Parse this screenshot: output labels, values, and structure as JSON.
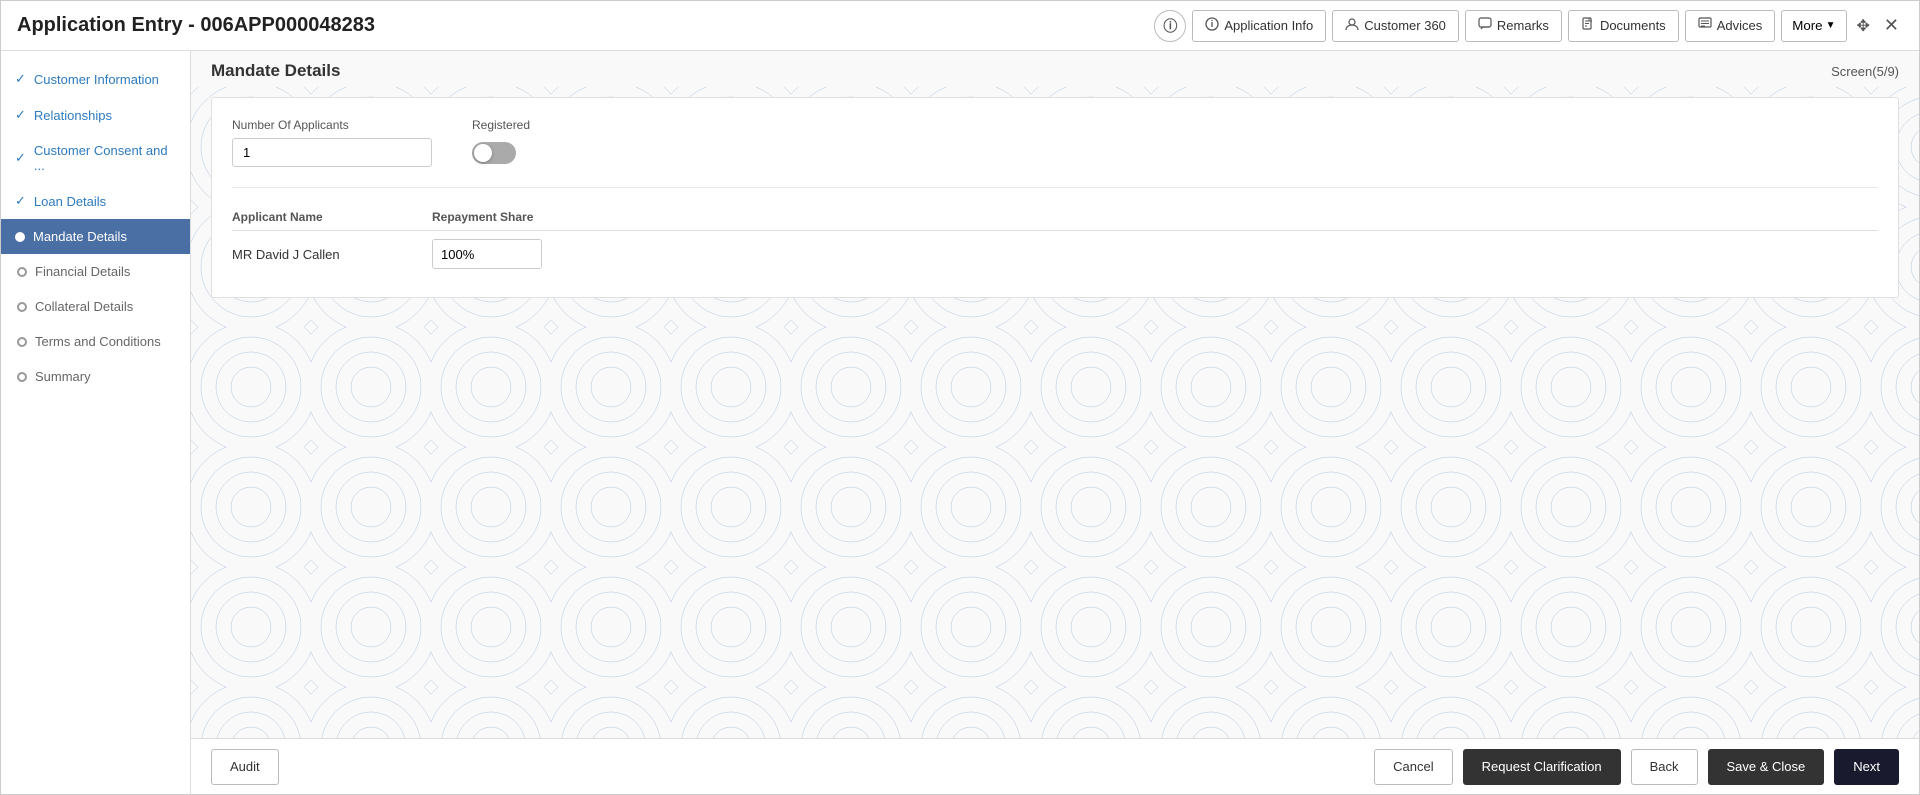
{
  "header": {
    "title": "Application Entry - 006APP000048283",
    "buttons": {
      "info": "i",
      "application_info": "Application Info",
      "customer_360": "Customer 360",
      "remarks": "Remarks",
      "documents": "Documents",
      "advices": "Advices",
      "more": "More"
    }
  },
  "sidebar": {
    "items": [
      {
        "id": "customer-information",
        "label": "Customer Information",
        "state": "completed"
      },
      {
        "id": "relationships",
        "label": "Relationships",
        "state": "completed"
      },
      {
        "id": "customer-consent",
        "label": "Customer Consent and ...",
        "state": "completed"
      },
      {
        "id": "loan-details",
        "label": "Loan Details",
        "state": "completed"
      },
      {
        "id": "mandate-details",
        "label": "Mandate Details",
        "state": "active"
      },
      {
        "id": "financial-details",
        "label": "Financial Details",
        "state": "inactive"
      },
      {
        "id": "collateral-details",
        "label": "Collateral Details",
        "state": "inactive"
      },
      {
        "id": "terms-conditions",
        "label": "Terms and Conditions",
        "state": "inactive"
      },
      {
        "id": "summary",
        "label": "Summary",
        "state": "inactive"
      }
    ]
  },
  "main": {
    "screen_title": "Mandate Details",
    "screen_number": "Screen(5/9)",
    "form": {
      "number_of_applicants_label": "Number Of Applicants",
      "number_of_applicants_value": "1",
      "registered_label": "Registered",
      "toggle_state": false,
      "table": {
        "col_applicant_name": "Applicant Name",
        "col_repayment_share": "Repayment Share",
        "rows": [
          {
            "name": "MR David J Callen",
            "share": "100%"
          }
        ]
      }
    }
  },
  "footer": {
    "audit_label": "Audit",
    "cancel_label": "Cancel",
    "request_clarification_label": "Request Clarification",
    "back_label": "Back",
    "save_close_label": "Save & Close",
    "next_label": "Next"
  }
}
